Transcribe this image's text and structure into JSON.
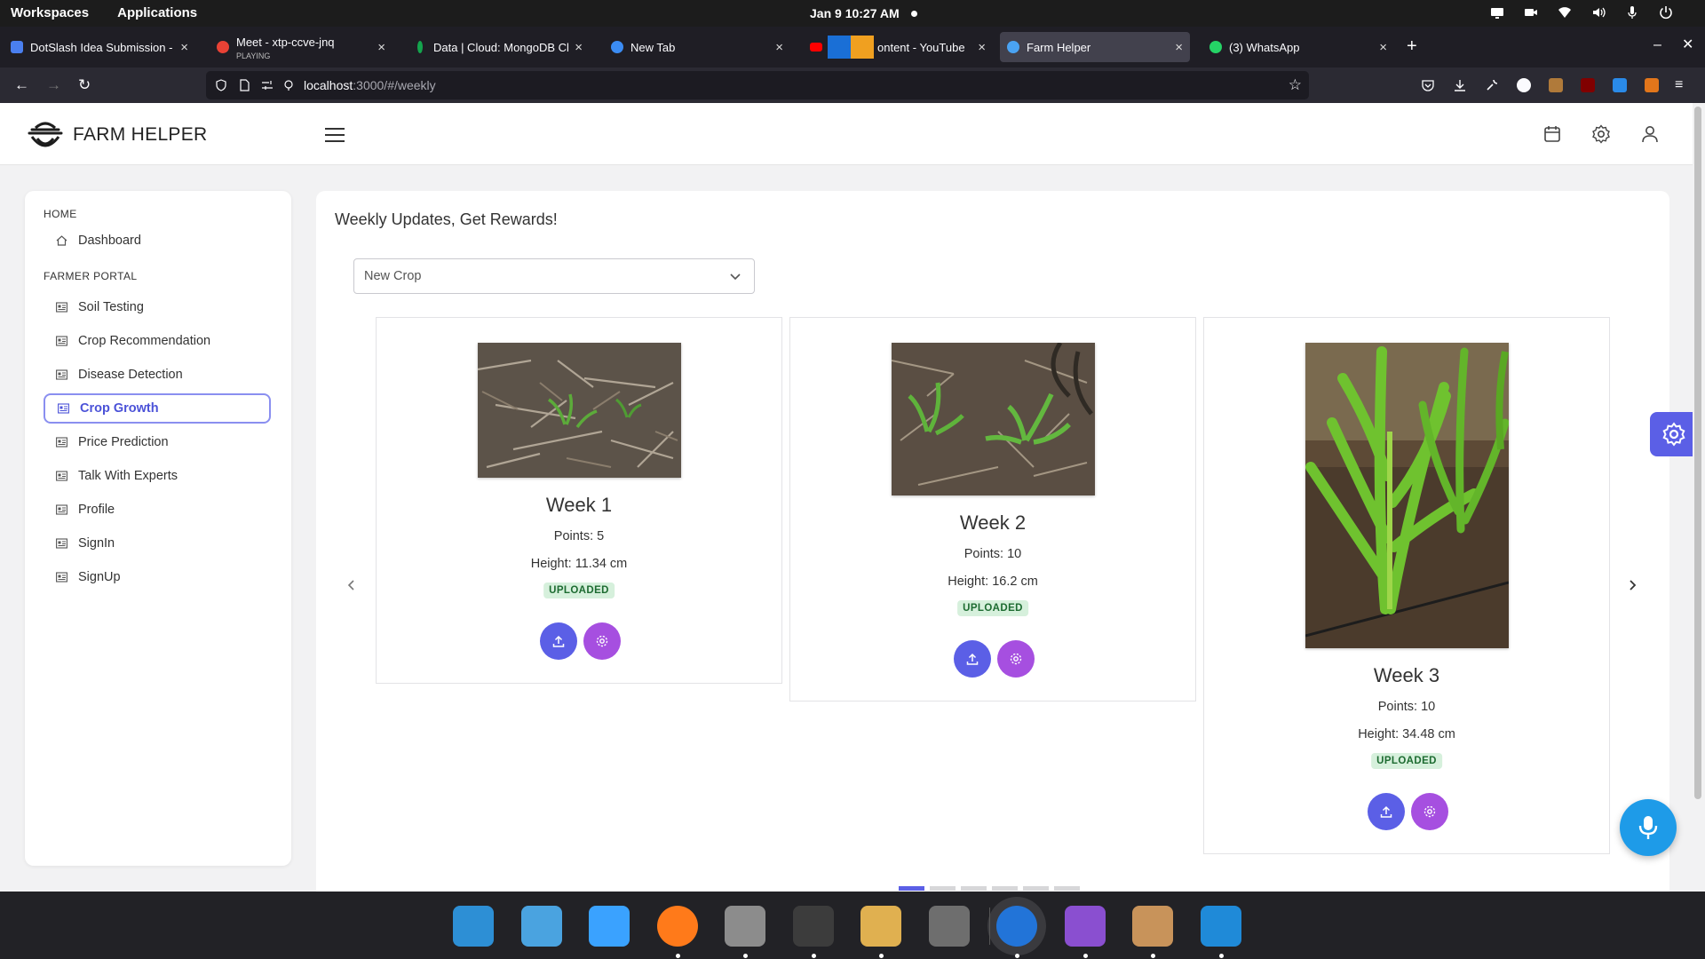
{
  "topbar": {
    "workspaces": "Workspaces",
    "applications": "Applications",
    "clock": "Jan 9  10:27 AM"
  },
  "tabs": [
    {
      "title": "DotSlash Idea Submission -",
      "favicon_color": "#4a7ff0"
    },
    {
      "title": "Meet - xtp-ccve-jnq",
      "subtitle": "PLAYING",
      "favicon_color": "#e94235"
    },
    {
      "title": "Data | Cloud: MongoDB Clou",
      "favicon_color": "#14a44d"
    },
    {
      "title": "New Tab",
      "favicon_color": "#3b8cf3"
    },
    {
      "title": "ontent - YouTube",
      "favicon_color": "#ff0000"
    },
    {
      "title": "Farm Helper",
      "favicon_color": "#4aa3f3",
      "active": true
    },
    {
      "title": "(3) WhatsApp",
      "favicon_color": "#25d366"
    }
  ],
  "urlbar": {
    "host": "localhost",
    "path": ":3000/#/weekly"
  },
  "app": {
    "brand": "FARM HELPER",
    "accent": "#5b5fe6",
    "secondary_accent": "#a64fe0"
  },
  "sidebar": {
    "home_section": "HOME",
    "dashboard": "Dashboard",
    "farmer_section": "FARMER PORTAL",
    "items": [
      {
        "label": "Soil Testing"
      },
      {
        "label": "Crop Recommendation"
      },
      {
        "label": "Disease Detection"
      },
      {
        "label": "Crop Growth",
        "active": true
      },
      {
        "label": "Price Prediction"
      },
      {
        "label": "Talk With Experts"
      },
      {
        "label": "Profile"
      },
      {
        "label": "SignIn"
      },
      {
        "label": "SignUp"
      }
    ]
  },
  "main": {
    "title": "Weekly Updates, Get Rewards!",
    "crop_select": "New Crop",
    "cards": [
      {
        "week": "Week 1",
        "points": "Points: 5",
        "height": "Height: 11.34 cm",
        "status": "UPLOADED"
      },
      {
        "week": "Week 2",
        "points": "Points: 10",
        "height": "Height: 16.2 cm",
        "status": "UPLOADED"
      },
      {
        "week": "Week 3",
        "points": "Points: 10",
        "height": "Height: 34.48 cm",
        "status": "UPLOADED"
      }
    ],
    "carousel_pages": 6,
    "carousel_active_page": 1
  },
  "dock": {
    "apps": [
      "search-app",
      "workspace-app",
      "app-grid",
      "firefox",
      "files",
      "terminal",
      "text-editor",
      "settings",
      "browser-active",
      "video-app",
      "package-app",
      "vscode"
    ]
  }
}
